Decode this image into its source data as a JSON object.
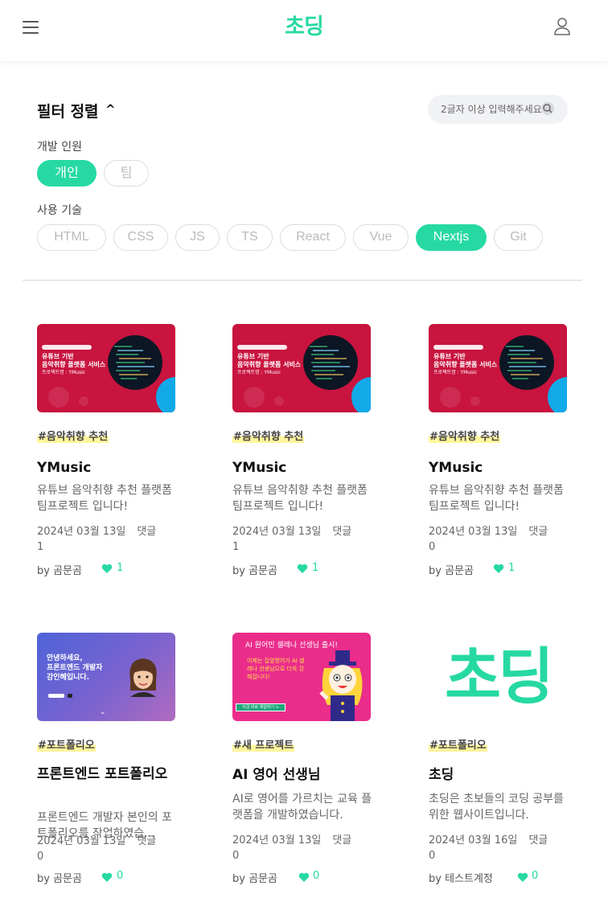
{
  "header": {
    "logo": "초딩",
    "menu_icon": "hamburger-icon",
    "user_icon": "user-icon"
  },
  "filter": {
    "title": "필터 정렬",
    "caret": "^",
    "search_placeholder": "2글자 이상 입력해주세요",
    "members_label": "개발 인원",
    "members": [
      {
        "label": "개인",
        "selected": true
      },
      {
        "label": "팀",
        "selected": false
      }
    ],
    "tech_label": "사용 기술",
    "techs": [
      {
        "label": "HTML",
        "selected": false
      },
      {
        "label": "CSS",
        "selected": false
      },
      {
        "label": "JS",
        "selected": false
      },
      {
        "label": "TS",
        "selected": false
      },
      {
        "label": "React",
        "selected": false
      },
      {
        "label": "Vue",
        "selected": false
      },
      {
        "label": "Nextjs",
        "selected": true
      },
      {
        "label": "Git",
        "selected": false
      }
    ]
  },
  "accent_color": "#26d9a2",
  "projects": [
    {
      "tag": "#음악취향 추천",
      "title": "YMusic",
      "desc": "유튜브 음악취향 추천 플랫폼 팀프로젝트 입니다!",
      "date": "2024년 03월 13일",
      "comments_label": "댓글",
      "comments": "1",
      "author": "by 곰문곰",
      "likes": "1",
      "thumb": {
        "line1": "유튜브 기반",
        "line2": "음악취향 플랫폼 서비스",
        "line3": "프로젝트명 : YMusic"
      }
    },
    {
      "tag": "#음악취향 추천",
      "title": "YMusic",
      "desc": "유튜브 음악취향 추천 플랫폼 팀프로젝트 입니다!",
      "date": "2024년 03월 13일",
      "comments_label": "댓글",
      "comments": "1",
      "author": "by 곰문곰",
      "likes": "1",
      "thumb": {
        "line1": "유튜브 기반",
        "line2": "음악취향 플랫폼 서비스",
        "line3": "프로젝트명 : YMusic"
      }
    },
    {
      "tag": "#음악취향 추천",
      "title": "YMusic",
      "desc": "유튜브 음악취향 추천 플랫폼 팀프로젝트 입니다!",
      "date": "2024년 03월 13일",
      "comments_label": "댓글",
      "comments": "0",
      "author": "by 곰문곰",
      "likes": "1",
      "thumb": {
        "line1": "유튜브 기반",
        "line2": "음악취향 플랫폼 서비스",
        "line3": "프로젝트명 : YMusic"
      }
    },
    {
      "tag": "#포트폴리오",
      "title": "프론트엔드 포트폴리오",
      "desc": "프론트엔드 개발자 본인의 포트폴리오를 작업하였습...",
      "date": "2024년 03월 13일",
      "comments_label": "댓글",
      "comments": "0",
      "author": "by 곰문곰",
      "likes": "0",
      "thumb": {
        "line1": "안녕하세요,",
        "line2": "프론트엔드 개발자",
        "line3": "강인혜입니다."
      }
    },
    {
      "tag": "#새 프로젝트",
      "title": "AI 영어 선생님",
      "desc": "AI로 영어를 가르치는 교육 플랫폼을 개발하였습니다.",
      "date": "2024년 03월 13일",
      "comments_label": "댓글",
      "comments": "0",
      "author": "by 곰문곰",
      "likes": "0",
      "thumb": {
        "line1": "AI 원어민 셀레나 선생님 출시!",
        "line2": "이제는 집앞영어가 AI 셀레나 선생님으로 더욱 강해집니다!",
        "line3": "지금 바로 체험하기 >"
      }
    },
    {
      "tag": "#포트폴리오",
      "title": "초딩",
      "desc": "초딩은 초보들의 코딩 공부를 위한 웹사이트입니다.",
      "date": "2024년 03월 16일",
      "comments_label": "댓글",
      "comments": "0",
      "author": "by 테스트계정",
      "likes": "0",
      "thumb": {
        "line1": "초딩"
      }
    }
  ]
}
